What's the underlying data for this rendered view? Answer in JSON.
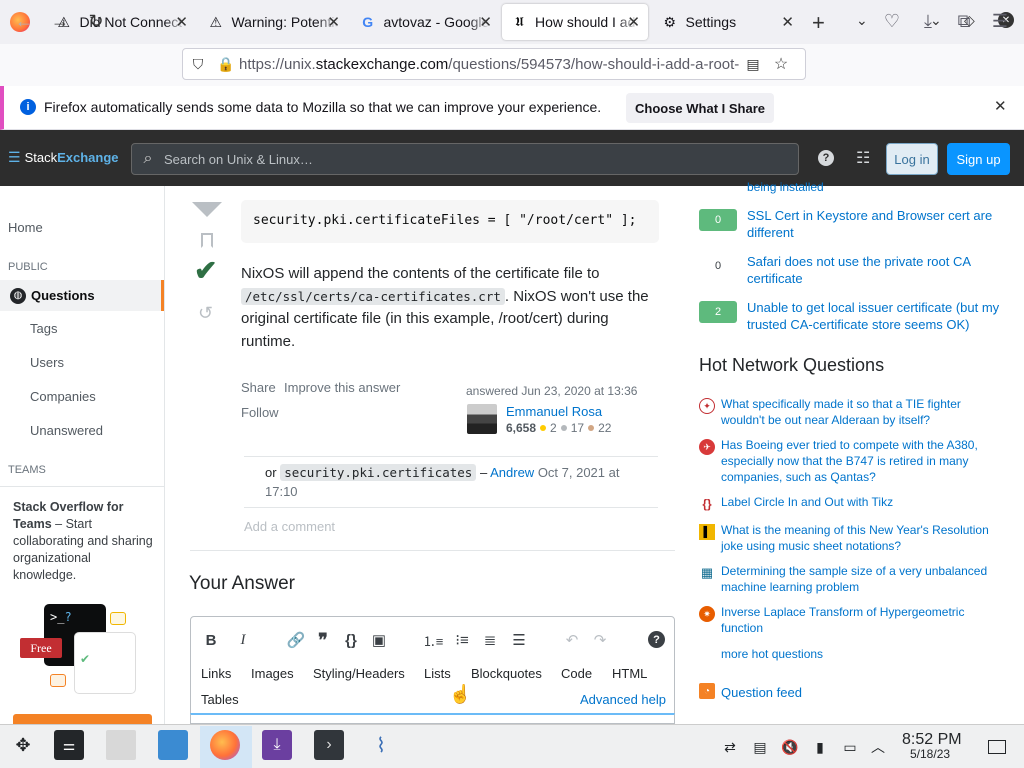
{
  "browser": {
    "tabs": [
      {
        "title": "Did Not Connect",
        "icon": "warning-icon"
      },
      {
        "title": "Warning: Potential",
        "icon": "warning-icon"
      },
      {
        "title": "avtovaz - Google",
        "icon": "google-icon"
      },
      {
        "title": "How should I add a root",
        "icon": "stackexchange-icon",
        "active": true
      },
      {
        "title": "Settings",
        "icon": "gear-icon"
      }
    ],
    "url_prefix": "https://unix.",
    "url_domain": "stackexchange.com",
    "url_path": "/questions/594573/how-should-i-add-a-root-",
    "notification": "Firefox automatically sends some data to Mozilla so that we can improve your experience.",
    "notification_button": "Choose What I Share"
  },
  "se": {
    "logo_a": "Stack",
    "logo_b": "Exchange",
    "search_placeholder": "Search on Unix & Linux…",
    "login": "Log in",
    "signup": "Sign up"
  },
  "leftnav": {
    "home": "Home",
    "public": "PUBLIC",
    "questions": "Questions",
    "tags": "Tags",
    "users": "Users",
    "companies": "Companies",
    "unanswered": "Unanswered",
    "teams": "TEAMS",
    "teams_title": "Stack Overflow for Teams",
    "teams_text": " – Start collaborating and sharing organizational knowledge.",
    "free_badge": "Free"
  },
  "answer": {
    "code_line": "security.pki.certificateFiles = [ \"/root/cert\" ];",
    "text_a": "NixOS will append the contents of the certificate file to",
    "code_path": "/etc/ssl/certs/ca-certificates.crt",
    "text_b": ". NixOS won't use the original certificate file (in this example, /root/cert) during runtime.",
    "share": "Share",
    "improve": "Improve this answer",
    "follow": "Follow",
    "answered": "answered Jun 23, 2020 at 13:36",
    "author": "Emmanuel Rosa",
    "rep": "6,658",
    "gold": "2",
    "silver": "17",
    "bronze": "22",
    "comment_or": "or",
    "comment_code": "security.pki.certificates",
    "comment_dash": "–",
    "comment_author": "Andrew",
    "comment_time": "Oct 7, 2021 at 17:10",
    "add_comment": "Add a comment"
  },
  "your_answer": {
    "heading": "Your Answer",
    "help_tabs": [
      "Links",
      "Images",
      "Styling/Headers",
      "Lists",
      "Blockquotes",
      "Code",
      "HTML"
    ],
    "tables": "Tables",
    "advanced_help": "Advanced help"
  },
  "related": [
    {
      "votes": "",
      "title": "being installed",
      "answered": false
    },
    {
      "votes": "0",
      "title": "SSL Cert in Keystore and Browser cert are different",
      "answered": true
    },
    {
      "votes": "0",
      "title": "Safari does not use the private root CA certificate",
      "answered": false
    },
    {
      "votes": "2",
      "title": "Unable to get local issuer certificate (but my trusted CA-certificate store seems OK)",
      "answered": true
    }
  ],
  "hot": {
    "heading": "Hot Network Questions",
    "items": [
      "What specifically made it so that a TIE fighter wouldn't be out near Alderaan by itself?",
      "Has Boeing ever tried to compete with the A380, especially now that the B747 is retired in many companies, such as Qantas?",
      "Label Circle In and Out with Tikz",
      "What is the meaning of this New Year's Resolution joke using music sheet notations?",
      "Determining the sample size of a very unbalanced machine learning problem",
      "Inverse Laplace Transform of Hypergeometric function"
    ],
    "more": "more hot questions",
    "feed": "Question feed"
  },
  "taskbar": {
    "time": "8:52 PM",
    "date": "5/18/23"
  },
  "colors": {
    "accent": "#0a95ff",
    "answered_green": "#5eba7d",
    "se_header": "#2d2d2d"
  }
}
